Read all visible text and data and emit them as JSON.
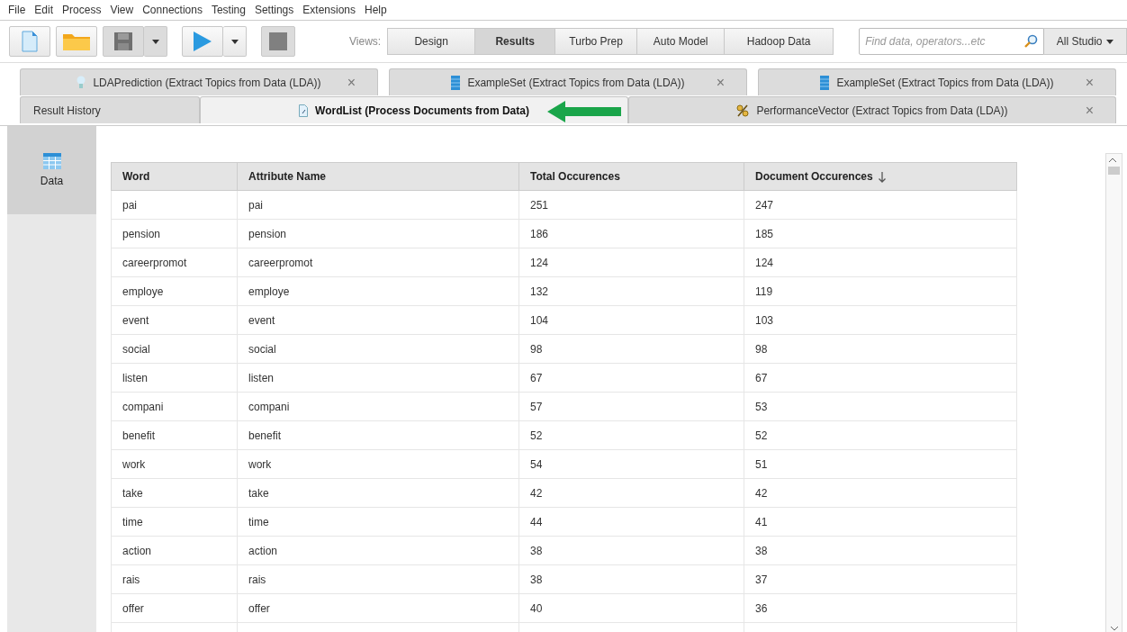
{
  "menu": [
    "File",
    "Edit",
    "Process",
    "View",
    "Connections",
    "Testing",
    "Settings",
    "Extensions",
    "Help"
  ],
  "toolbar": {
    "buttons": [
      {
        "kind": "new",
        "disabled": false
      },
      {
        "kind": "open",
        "disabled": false
      },
      {
        "kind": "save",
        "disabled": true
      },
      {
        "kind": "run",
        "disabled": false
      },
      {
        "kind": "stop",
        "disabled": true
      }
    ],
    "views_label": "Views:",
    "views": [
      {
        "label": "Design",
        "selected": false
      },
      {
        "label": "Results",
        "selected": true
      },
      {
        "label": "Turbo Prep",
        "selected": false
      },
      {
        "label": "Auto Model",
        "selected": false
      },
      {
        "label": "Hadoop Data",
        "selected": false
      }
    ],
    "search": {
      "placeholder": "Find data, operators...etc"
    },
    "scope": "All Studio"
  },
  "tab_rows": [
    [
      {
        "label": "LDAPrediction (Extract Topics from Data (LDA))",
        "kind": "model",
        "close": "×",
        "selected": false
      },
      {
        "label": "ExampleSet (Extract Topics from Data (LDA))",
        "kind": "exampleset",
        "close": "×",
        "selected": false
      },
      {
        "label": "ExampleSet (Extract Topics from Data (LDA))",
        "kind": "exampleset",
        "close": "×",
        "selected": false
      }
    ],
    [
      {
        "label": "Result History",
        "kind": "history",
        "selected": false
      },
      {
        "label": "WordList (Process Documents from Data)",
        "kind": "wordlist",
        "selected": true
      },
      {
        "label": "PerformanceVector (Extract Topics from Data (LDA))",
        "kind": "performance",
        "close": "×",
        "selected": false
      }
    ]
  ],
  "sidebar": [
    {
      "label": "Data",
      "selected": true
    }
  ],
  "table": {
    "columns": [
      {
        "label": "Word",
        "sorted": false
      },
      {
        "label": "Attribute Name",
        "sorted": false
      },
      {
        "label": "Total Occurences",
        "sorted": false
      },
      {
        "label": "Document Occurences",
        "sorted": true
      }
    ],
    "rows": [
      [
        "pai",
        "pai",
        "251",
        "247"
      ],
      [
        "pension",
        "pension",
        "186",
        "185"
      ],
      [
        "careerpromot",
        "careerpromot",
        "124",
        "124"
      ],
      [
        "employe",
        "employe",
        "132",
        "119"
      ],
      [
        "event",
        "event",
        "104",
        "103"
      ],
      [
        "social",
        "social",
        "98",
        "98"
      ],
      [
        "listen",
        "listen",
        "67",
        "67"
      ],
      [
        "compani",
        "compani",
        "57",
        "53"
      ],
      [
        "benefit",
        "benefit",
        "52",
        "52"
      ],
      [
        "work",
        "work",
        "54",
        "51"
      ],
      [
        "take",
        "take",
        "42",
        "42"
      ],
      [
        "time",
        "time",
        "44",
        "41"
      ],
      [
        "action",
        "action",
        "38",
        "38"
      ],
      [
        "rais",
        "rais",
        "38",
        "37"
      ],
      [
        "offer",
        "offer",
        "40",
        "36"
      ]
    ]
  }
}
